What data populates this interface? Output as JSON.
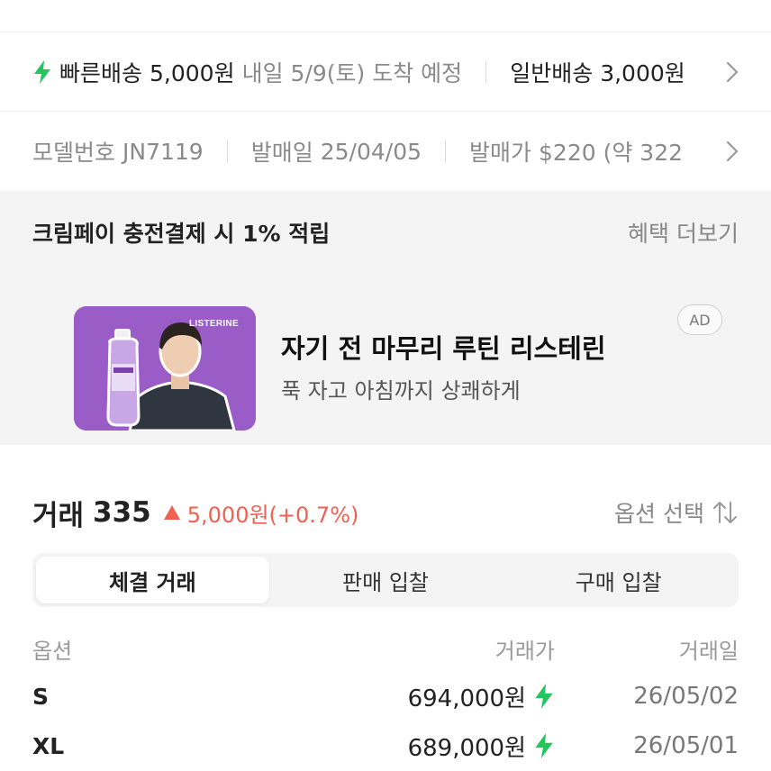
{
  "shipping": {
    "fast_label": "빠른배송",
    "fast_price": "5,000원",
    "fast_eta": "내일 5/9(토) 도착 예정",
    "normal_label": "일반배송",
    "normal_price": "3,000원"
  },
  "product_info": {
    "model_label": "모델번호",
    "model_value": "JN7119",
    "release_label": "발매일",
    "release_value": "25/04/05",
    "retail_label": "발매가",
    "retail_value": "$220 (약 322"
  },
  "benefit": {
    "text": "크림페이 충전결제 시 1% 적립",
    "more_label": "혜택 더보기"
  },
  "ad": {
    "brand": "LISTERINE",
    "title": "자기 전 마무리 루틴 리스테린",
    "subtitle": "푹 자고 아침까지 상쾌하게",
    "badge": "AD"
  },
  "trades": {
    "title": "거래",
    "count": "335",
    "change": "5,000원(+0.7%)",
    "option_select_label": "옵션 선택",
    "tabs": [
      {
        "label": "체결 거래",
        "active": true
      },
      {
        "label": "판매 입찰",
        "active": false
      },
      {
        "label": "구매 입찰",
        "active": false
      }
    ],
    "columns": {
      "option": "옵션",
      "price": "거래가",
      "date": "거래일"
    },
    "rows": [
      {
        "option": "S",
        "price": "694,000원",
        "date": "26/05/02"
      },
      {
        "option": "XL",
        "price": "689,000원",
        "date": "26/05/01"
      }
    ]
  },
  "colors": {
    "accent_green": "#22c55e",
    "price_up_red": "#ef6253",
    "ad_purple": "#9a5cc6"
  },
  "icons": [
    "lightning-icon",
    "chevron-right-icon",
    "sort-arrows-icon",
    "triangle-up-icon"
  ]
}
